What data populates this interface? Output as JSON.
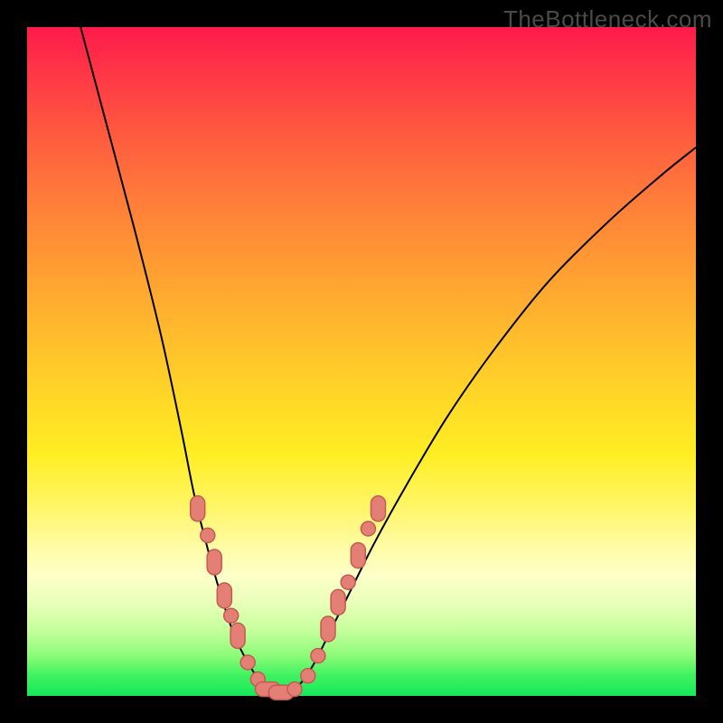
{
  "watermark": "TheBottleneck.com",
  "chart_data": {
    "type": "line",
    "title": "",
    "xlabel": "",
    "ylabel": "",
    "xlim": [
      0,
      100
    ],
    "ylim": [
      0,
      100
    ],
    "series": [
      {
        "name": "bottleneck-curve",
        "points": [
          {
            "x": 8,
            "y": 100
          },
          {
            "x": 12,
            "y": 85
          },
          {
            "x": 16,
            "y": 70
          },
          {
            "x": 20,
            "y": 54
          },
          {
            "x": 23,
            "y": 40
          },
          {
            "x": 25,
            "y": 30
          },
          {
            "x": 27,
            "y": 22
          },
          {
            "x": 29,
            "y": 15
          },
          {
            "x": 31,
            "y": 9
          },
          {
            "x": 33,
            "y": 5
          },
          {
            "x": 35,
            "y": 2
          },
          {
            "x": 37,
            "y": 0.5
          },
          {
            "x": 39,
            "y": 0.5
          },
          {
            "x": 41,
            "y": 2
          },
          {
            "x": 43,
            "y": 5
          },
          {
            "x": 45,
            "y": 9
          },
          {
            "x": 48,
            "y": 15
          },
          {
            "x": 52,
            "y": 23
          },
          {
            "x": 57,
            "y": 32
          },
          {
            "x": 63,
            "y": 42
          },
          {
            "x": 70,
            "y": 52
          },
          {
            "x": 78,
            "y": 62
          },
          {
            "x": 87,
            "y": 71
          },
          {
            "x": 95,
            "y": 78
          },
          {
            "x": 100,
            "y": 82
          }
        ]
      }
    ],
    "markers": [
      {
        "x": 25.5,
        "y": 28,
        "shape": "pill-v"
      },
      {
        "x": 27.0,
        "y": 24,
        "shape": "dot"
      },
      {
        "x": 28.0,
        "y": 20,
        "shape": "pill-v"
      },
      {
        "x": 29.5,
        "y": 15,
        "shape": "pill-v"
      },
      {
        "x": 30.5,
        "y": 12,
        "shape": "dot"
      },
      {
        "x": 31.5,
        "y": 9,
        "shape": "pill-v"
      },
      {
        "x": 33.0,
        "y": 5,
        "shape": "dot"
      },
      {
        "x": 34.5,
        "y": 2.5,
        "shape": "dot"
      },
      {
        "x": 36.0,
        "y": 1,
        "shape": "pill-h"
      },
      {
        "x": 38.0,
        "y": 0.5,
        "shape": "pill-h"
      },
      {
        "x": 40.0,
        "y": 1,
        "shape": "dot"
      },
      {
        "x": 42.0,
        "y": 3,
        "shape": "dot"
      },
      {
        "x": 43.5,
        "y": 6,
        "shape": "dot"
      },
      {
        "x": 45.0,
        "y": 10,
        "shape": "pill-v"
      },
      {
        "x": 46.5,
        "y": 14,
        "shape": "pill-v"
      },
      {
        "x": 48.0,
        "y": 17,
        "shape": "dot"
      },
      {
        "x": 49.5,
        "y": 21,
        "shape": "pill-v"
      },
      {
        "x": 51.0,
        "y": 25,
        "shape": "dot"
      },
      {
        "x": 52.5,
        "y": 28,
        "shape": "pill-v"
      }
    ],
    "background_gradient_note": "vertical gradient red (top) → orange → yellow → pale → green (bottom), roughly 0-100% bottleneck severity"
  }
}
